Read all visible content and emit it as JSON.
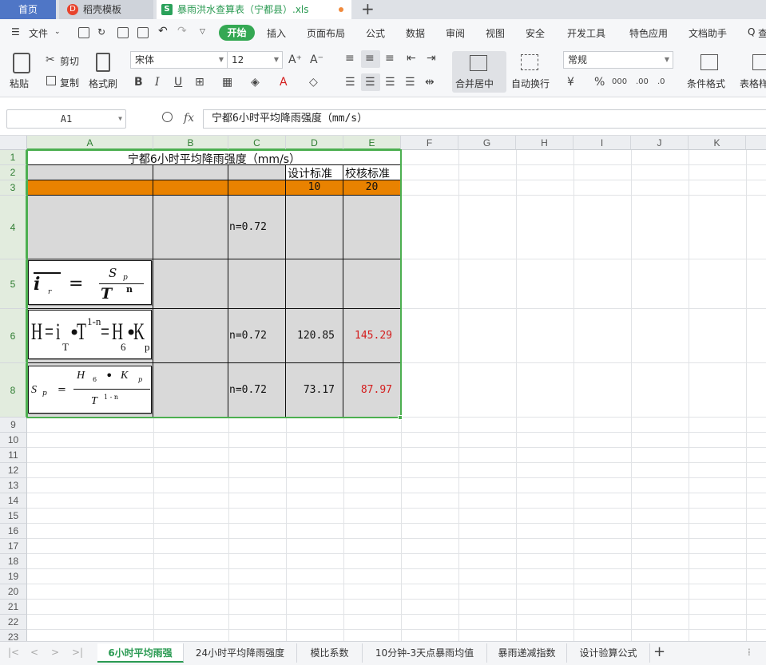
{
  "tabs": {
    "home": "首页",
    "template": "稻壳模板",
    "file": "暴雨洪水查算表（宁都县）.xls",
    "file_icon": "S",
    "template_icon": "D"
  },
  "menu": {
    "file": "文件",
    "start": "开始",
    "items": [
      "插入",
      "页面布局",
      "公式",
      "数据",
      "审阅",
      "视图",
      "安全",
      "开发工具",
      "特色应用",
      "文档助手"
    ],
    "search_prefix": "Q",
    "search_label": "查"
  },
  "ribbon": {
    "paste": "粘贴",
    "cut": "剪切",
    "copy": "复制",
    "format_painter": "格式刷",
    "font_name": "宋体",
    "font_size": "12",
    "merge_center": "合并居中",
    "wrap_text": "自动换行",
    "number_format": "常规",
    "percent": "%",
    "comma": "000",
    "inc_decimal": ".00",
    "dec_decimal": ".0",
    "conditional_format": "条件格式",
    "table_style": "表格样"
  },
  "formula_bar": {
    "name_box": "A1",
    "fx": "fx",
    "content": "宁都6小时平均降雨强度（mm/s）"
  },
  "columns": [
    "A",
    "B",
    "C",
    "D",
    "E",
    "F",
    "G",
    "H",
    "I",
    "J",
    "K"
  ],
  "rows": [
    "1",
    "2",
    "3",
    "4",
    "5",
    "6",
    "8",
    "9",
    "10",
    "11",
    "12",
    "13",
    "14",
    "15",
    "16",
    "17",
    "18",
    "19",
    "20",
    "21",
    "22",
    "23"
  ],
  "cells": {
    "title": "宁都6小时平均降雨强度（mm/s）",
    "d2": "设计标准",
    "e2": "校核标准",
    "d3": "10",
    "e3": "20",
    "c4": "n=0.72",
    "c6": "n=0.72",
    "d6": "120.85",
    "e6": "145.29",
    "c8": "n=0.72",
    "d8": "73.17",
    "e8": "87.97"
  },
  "formulas": {
    "f5": {
      "lhs": "i",
      "sub": "r",
      "eq": "=",
      "num": "S",
      "num_sub": "p",
      "den": "T",
      "den_sup": "n"
    },
    "f6": {
      "a": "H",
      "eq1": "=",
      "b": "i",
      "bsub": "T",
      "dot1": "•",
      "c": "T",
      "csup": "1-n",
      "eq2": "=",
      "d": "H",
      "dsub": "6",
      "dot2": "•",
      "e": "K",
      "esub": "p"
    },
    "f8": {
      "lhs": "S",
      "lsub": "p",
      "eq": "=",
      "n1": "H",
      "n1sub": "6",
      "dot": "•",
      "n2": "K",
      "n2sub": "p",
      "den": "T",
      "den_sup": "1 - n"
    }
  },
  "sheets": [
    "6小时平均雨强",
    "24小时平均降雨强度",
    "模比系数",
    "10分钟-3天点暴雨均值",
    "暴雨递减指数",
    "设计验算公式"
  ],
  "colors": {
    "accent": "#34a853",
    "orange_row": "#e98200",
    "gray_fill": "#d9d9d9",
    "red_value": "#d41e1e",
    "selection": "#4caf50"
  }
}
